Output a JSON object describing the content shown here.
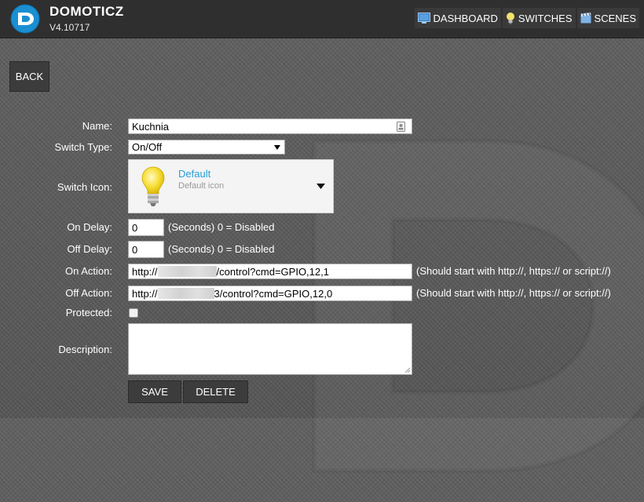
{
  "app": {
    "title": "DOMOTICZ",
    "version": "V4.10717"
  },
  "nav": [
    {
      "label": "DASHBOARD",
      "icon": "dashboard-icon"
    },
    {
      "label": "SWITCHES",
      "icon": "lightbulb-icon"
    },
    {
      "label": "SCENES",
      "icon": "clapperboard-icon"
    }
  ],
  "back_label": "BACK",
  "form": {
    "name": {
      "label": "Name:",
      "value": "Kuchnia"
    },
    "switch_type": {
      "label": "Switch Type:",
      "value": "On/Off"
    },
    "switch_icon": {
      "label": "Switch Icon:",
      "name": "Default",
      "description": "Default icon"
    },
    "on_delay": {
      "label": "On Delay:",
      "value": "0",
      "hint": "(Seconds) 0 = Disabled"
    },
    "off_delay": {
      "label": "Off Delay:",
      "value": "0",
      "hint": "(Seconds) 0 = Disabled"
    },
    "on_action": {
      "label": "On Action:",
      "prefix": "http://",
      "suffix": "/control?cmd=GPIO,12,1",
      "hint": "(Should start with http://, https:// or script://)"
    },
    "off_action": {
      "label": "Off Action:",
      "prefix": "http://",
      "suffix": "3/control?cmd=GPIO,12,0",
      "hint": "(Should start with http://, https:// or script://)"
    },
    "protected": {
      "label": "Protected:",
      "checked": false
    },
    "description": {
      "label": "Description:",
      "value": ""
    }
  },
  "buttons": {
    "save": "SAVE",
    "delete": "DELETE"
  },
  "colors": {
    "accent": "#2a9fd6",
    "topbar": "#2f2f2f",
    "button": "#3c3c3c"
  }
}
